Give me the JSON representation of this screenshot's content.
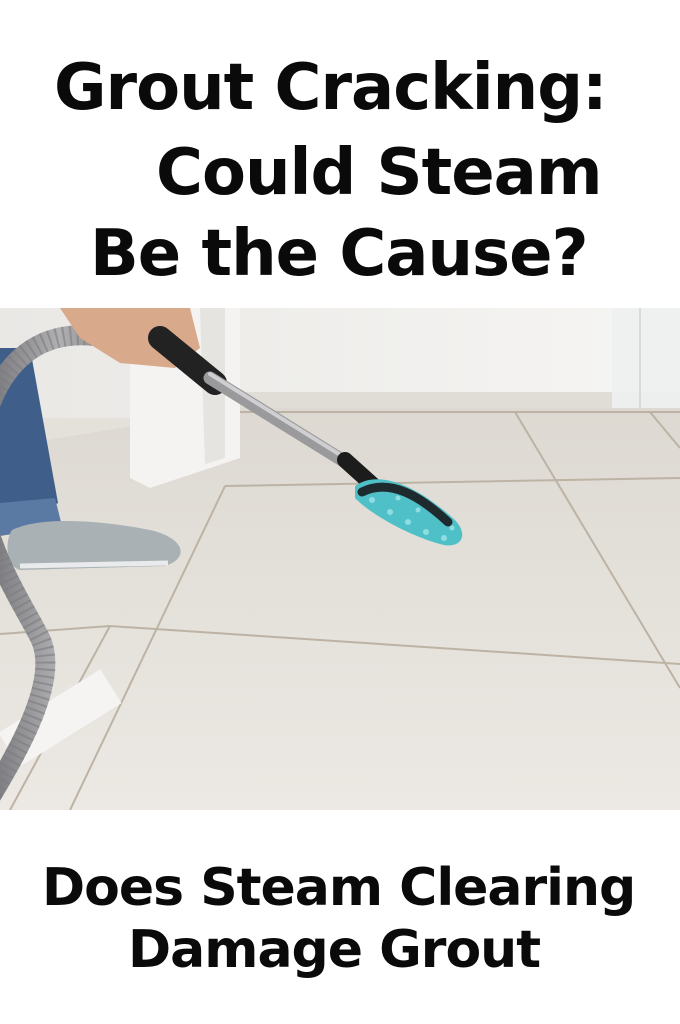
{
  "title": {
    "line1": "Grout Cracking:",
    "line2": "Could Steam",
    "line3": "Be the Cause?"
  },
  "image": {
    "subject": "steam-mop-cleaning-tile-floor-photo",
    "colors": {
      "floor": "#e6e2dc",
      "wall": "#f3f2ef",
      "grout": "#b8ae9f",
      "mop_pad": "#4fc0c8",
      "hose": "#8f8f92",
      "jeans": "#3f5f8a"
    }
  },
  "subtitle": {
    "line1": "Does Steam Clearing",
    "line2": "Damage Grout"
  }
}
